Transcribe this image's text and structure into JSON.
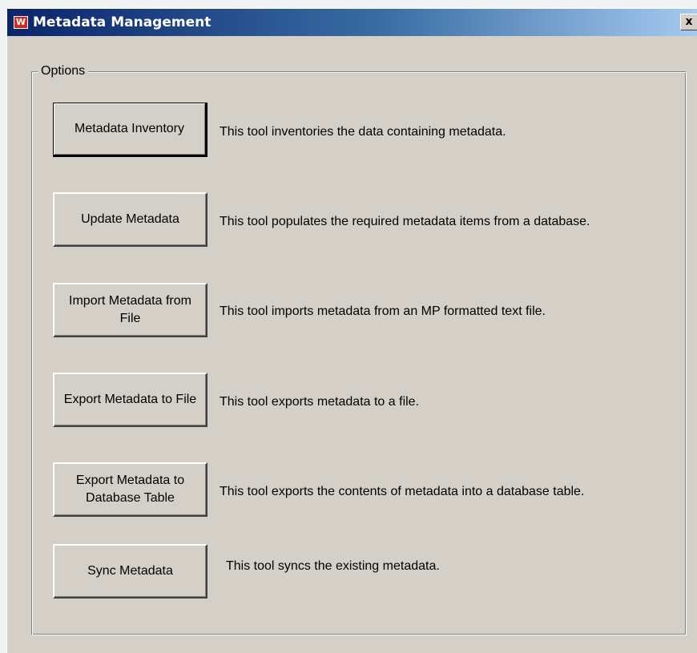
{
  "window": {
    "title": "Metadata Management",
    "close_glyph": "x",
    "app_icon_glyph": "W"
  },
  "options": {
    "label": "Options",
    "tools": [
      {
        "button": "Metadata Inventory",
        "description": "This tool inventories the data containing metadata."
      },
      {
        "button": "Update Metadata",
        "description": "This tool populates the required metadata items from a database."
      },
      {
        "button": "Import Metadata from File",
        "description": "This tool imports metadata from an MP formatted text file."
      },
      {
        "button": "Export Metadata to File",
        "description": "This tool exports metadata to a file."
      },
      {
        "button": "Export Metadata to Database Table",
        "description": "This tool exports the contents of metadata into a database table."
      },
      {
        "button": "Sync Metadata",
        "description": "This tool syncs the existing metadata."
      }
    ]
  },
  "colors": {
    "titlebar_start": "#0a246a",
    "titlebar_end": "#a6caf0",
    "face": "#d4d0c8",
    "app_icon": "#d42a1c"
  }
}
